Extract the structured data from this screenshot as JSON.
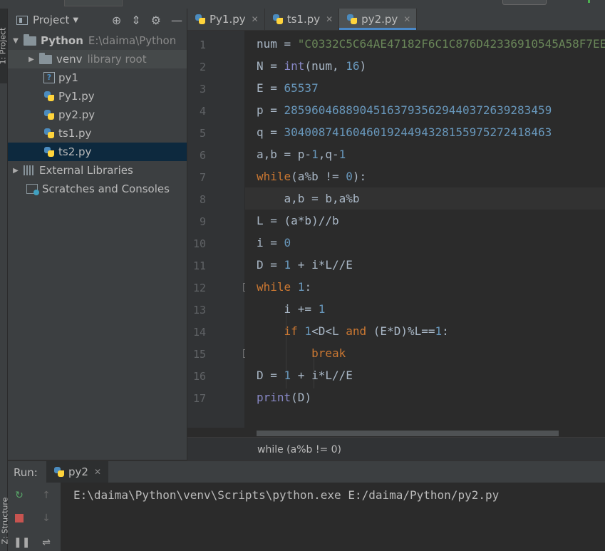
{
  "project_panel": {
    "title": "Project",
    "tree": {
      "root_name": "Python",
      "root_path": "E:\\daima\\Python",
      "venv_name": "venv",
      "venv_hint": "library root",
      "files": [
        "py1",
        "Py1.py",
        "py2.py",
        "ts1.py",
        "ts2.py"
      ],
      "external_libraries": "External Libraries",
      "scratches": "Scratches and Consoles"
    },
    "side_tab": "1: Project"
  },
  "editor": {
    "tabs": [
      {
        "label": "Py1.py"
      },
      {
        "label": "ts1.py"
      },
      {
        "label": "py2.py",
        "active": true
      }
    ],
    "line_numbers": [
      "1",
      "2",
      "3",
      "4",
      "5",
      "6",
      "7",
      "8",
      "9",
      "10",
      "11",
      "12",
      "13",
      "14",
      "15",
      "16",
      "17"
    ],
    "breadcrumb": "while (a%b != 0)"
  },
  "run_panel": {
    "label": "Run:",
    "tab": "py2",
    "output": "E:\\daima\\Python\\venv\\Scripts\\python.exe E:/daima/Python/py2.py",
    "side_tab": "Z: Structure"
  },
  "colors": {
    "keyword": "#cc7832",
    "string": "#6a8759",
    "number": "#6897bb",
    "builtin": "#8888c6",
    "selection": "#0d293e",
    "accent": "#4a88c7"
  }
}
